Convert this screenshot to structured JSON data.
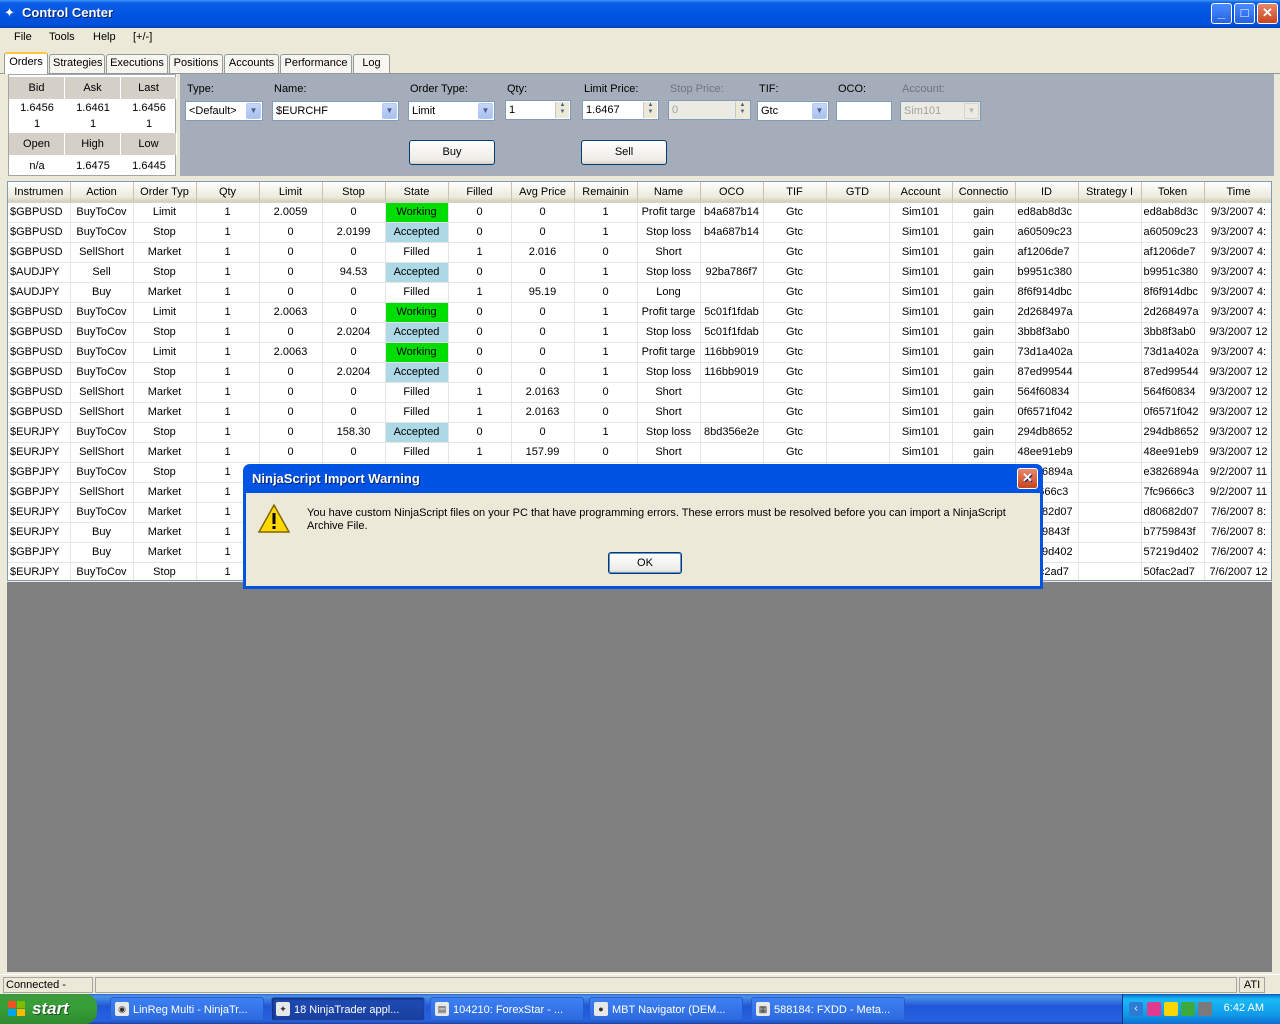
{
  "window": {
    "title": "Control Center",
    "min": "_",
    "max": "□",
    "close": "✕"
  },
  "menu": [
    "File",
    "Tools",
    "Help",
    "[+/-]"
  ],
  "tabs": [
    "Orders",
    "Strategies",
    "Executions",
    "Positions",
    "Accounts",
    "Performance",
    "Log"
  ],
  "active_tab": "Orders",
  "quote": {
    "bid_label": "Bid",
    "ask_label": "Ask",
    "last_label": "Last",
    "bid": "1.6456",
    "ask": "1.6461",
    "last": "1.6456",
    "bid_size": "1",
    "ask_size": "1",
    "last_size": "1",
    "open_label": "Open",
    "high_label": "High",
    "low_label": "Low",
    "open": "n/a",
    "high": "1.6475",
    "low": "1.6445"
  },
  "entry": {
    "type_label": "Type:",
    "type_value": "<Default>",
    "name_label": "Name:",
    "name_value": "$EURCHF",
    "ordertype_label": "Order Type:",
    "ordertype_value": "Limit",
    "qty_label": "Qty:",
    "qty_value": "1",
    "limit_label": "Limit Price:",
    "limit_value": "1.6467",
    "stop_label": "Stop Price:",
    "stop_value": "0",
    "tif_label": "TIF:",
    "tif_value": "Gtc",
    "oco_label": "OCO:",
    "oco_value": "",
    "account_label": "Account:",
    "account_value": "Sim101",
    "buy_label": "Buy",
    "sell_label": "Sell"
  },
  "columns": [
    "Instrumen",
    "Action",
    "Order Typ",
    "Qty",
    "Limit",
    "Stop",
    "State",
    "Filled",
    "Avg Price",
    "Remainin",
    "Name",
    "OCO",
    "TIF",
    "GTD",
    "Account",
    "Connectio",
    "ID",
    "Strategy I",
    "Token",
    "Time"
  ],
  "rows": [
    [
      "$GBPUSD",
      "BuyToCov",
      "Limit",
      "1",
      "2.0059",
      "0",
      "Working",
      "0",
      "0",
      "1",
      "Profit targe",
      "b4a687b14",
      "Gtc",
      "",
      "Sim101",
      "gain",
      "ed8ab8d3c",
      "",
      "ed8ab8d3c",
      "9/3/2007 4:"
    ],
    [
      "$GBPUSD",
      "BuyToCov",
      "Stop",
      "1",
      "0",
      "2.0199",
      "Accepted",
      "0",
      "0",
      "1",
      "Stop loss",
      "b4a687b14",
      "Gtc",
      "",
      "Sim101",
      "gain",
      "a60509c23",
      "",
      "a60509c23",
      "9/3/2007 4:"
    ],
    [
      "$GBPUSD",
      "SellShort",
      "Market",
      "1",
      "0",
      "0",
      "Filled",
      "1",
      "2.016",
      "0",
      "Short",
      "",
      "Gtc",
      "",
      "Sim101",
      "gain",
      "af1206de7",
      "",
      "af1206de7",
      "9/3/2007 4:"
    ],
    [
      "$AUDJPY",
      "Sell",
      "Stop",
      "1",
      "0",
      "94.53",
      "Accepted",
      "0",
      "0",
      "1",
      "Stop loss",
      "92ba786f7",
      "Gtc",
      "",
      "Sim101",
      "gain",
      "b9951c380",
      "",
      "b9951c380",
      "9/3/2007 4:"
    ],
    [
      "$AUDJPY",
      "Buy",
      "Market",
      "1",
      "0",
      "0",
      "Filled",
      "1",
      "95.19",
      "0",
      "Long",
      "",
      "Gtc",
      "",
      "Sim101",
      "gain",
      "8f6f914dbc",
      "",
      "8f6f914dbc",
      "9/3/2007 4:"
    ],
    [
      "$GBPUSD",
      "BuyToCov",
      "Limit",
      "1",
      "2.0063",
      "0",
      "Working",
      "0",
      "0",
      "1",
      "Profit targe",
      "5c01f1fdab",
      "Gtc",
      "",
      "Sim101",
      "gain",
      "2d268497a",
      "",
      "2d268497a",
      "9/3/2007 4:"
    ],
    [
      "$GBPUSD",
      "BuyToCov",
      "Stop",
      "1",
      "0",
      "2.0204",
      "Accepted",
      "0",
      "0",
      "1",
      "Stop loss",
      "5c01f1fdab",
      "Gtc",
      "",
      "Sim101",
      "gain",
      "3bb8f3ab0",
      "",
      "3bb8f3ab0",
      "9/3/2007 12"
    ],
    [
      "$GBPUSD",
      "BuyToCov",
      "Limit",
      "1",
      "2.0063",
      "0",
      "Working",
      "0",
      "0",
      "1",
      "Profit targe",
      "116bb9019",
      "Gtc",
      "",
      "Sim101",
      "gain",
      "73d1a402a",
      "",
      "73d1a402a",
      "9/3/2007 4:"
    ],
    [
      "$GBPUSD",
      "BuyToCov",
      "Stop",
      "1",
      "0",
      "2.0204",
      "Accepted",
      "0",
      "0",
      "1",
      "Stop loss",
      "116bb9019",
      "Gtc",
      "",
      "Sim101",
      "gain",
      "87ed99544",
      "",
      "87ed99544",
      "9/3/2007 12"
    ],
    [
      "$GBPUSD",
      "SellShort",
      "Market",
      "1",
      "0",
      "0",
      "Filled",
      "1",
      "2.0163",
      "0",
      "Short",
      "",
      "Gtc",
      "",
      "Sim101",
      "gain",
      "564f60834",
      "",
      "564f60834",
      "9/3/2007 12"
    ],
    [
      "$GBPUSD",
      "SellShort",
      "Market",
      "1",
      "0",
      "0",
      "Filled",
      "1",
      "2.0163",
      "0",
      "Short",
      "",
      "Gtc",
      "",
      "Sim101",
      "gain",
      "0f6571f042",
      "",
      "0f6571f042",
      "9/3/2007 12"
    ],
    [
      "$EURJPY",
      "BuyToCov",
      "Stop",
      "1",
      "0",
      "158.30",
      "Accepted",
      "0",
      "0",
      "1",
      "Stop loss",
      "8bd356e2e",
      "Gtc",
      "",
      "Sim101",
      "gain",
      "294db8652",
      "",
      "294db8652",
      "9/3/2007 12"
    ],
    [
      "$EURJPY",
      "SellShort",
      "Market",
      "1",
      "0",
      "0",
      "Filled",
      "1",
      "157.99",
      "0",
      "Short",
      "",
      "Gtc",
      "",
      "Sim101",
      "gain",
      "48ee91eb9",
      "",
      "48ee91eb9",
      "9/3/2007 12"
    ],
    [
      "$GBPJPY",
      "BuyToCov",
      "Stop",
      "1",
      "",
      "",
      "",
      "",
      "",
      "",
      "",
      "",
      "",
      "",
      "",
      "",
      "e3826894a",
      "",
      "e3826894a",
      "9/2/2007 11"
    ],
    [
      "$GBPJPY",
      "SellShort",
      "Market",
      "1",
      "",
      "",
      "",
      "",
      "",
      "",
      "",
      "",
      "",
      "",
      "",
      "",
      "7fc9666c3",
      "",
      "7fc9666c3",
      "9/2/2007 11"
    ],
    [
      "$EURJPY",
      "BuyToCov",
      "Market",
      "1",
      "",
      "",
      "",
      "",
      "",
      "",
      "",
      "",
      "",
      "",
      "",
      "",
      "d80682d07",
      "",
      "d80682d07",
      "7/6/2007 8:"
    ],
    [
      "$EURJPY",
      "Buy",
      "Market",
      "1",
      "",
      "",
      "",
      "",
      "",
      "",
      "",
      "",
      "",
      "",
      "",
      "",
      "b7759843f",
      "",
      "b7759843f",
      "7/6/2007 8:"
    ],
    [
      "$GBPJPY",
      "Buy",
      "Market",
      "1",
      "",
      "",
      "",
      "",
      "",
      "",
      "",
      "",
      "",
      "",
      "",
      "",
      "57219d402",
      "",
      "57219d402",
      "7/6/2007 4:"
    ],
    [
      "$EURJPY",
      "BuyToCov",
      "Stop",
      "1",
      "",
      "",
      "",
      "",
      "",
      "",
      "",
      "",
      "",
      "",
      "",
      "",
      "50fac2ad7",
      "",
      "50fac2ad7",
      "7/6/2007 12"
    ]
  ],
  "dialog": {
    "title": "NinjaScript Import Warning",
    "message": "You have custom NinjaScript files on your PC that have programming errors. These errors must be resolved before you can import a NinjaScript Archive File.",
    "ok": "OK",
    "icon": "warning-icon"
  },
  "statusbar": {
    "left": "Connected - Gain",
    "right": "ATI"
  },
  "taskbar": {
    "start": "start",
    "tasks": [
      "LinReg Multi - NinjaTr...",
      "18 NinjaTrader appl...",
      "104210: ForexStar - ...",
      "MBT Navigator (DEM...",
      "588184: FXDD - Meta..."
    ],
    "clock": "6:42 AM"
  }
}
